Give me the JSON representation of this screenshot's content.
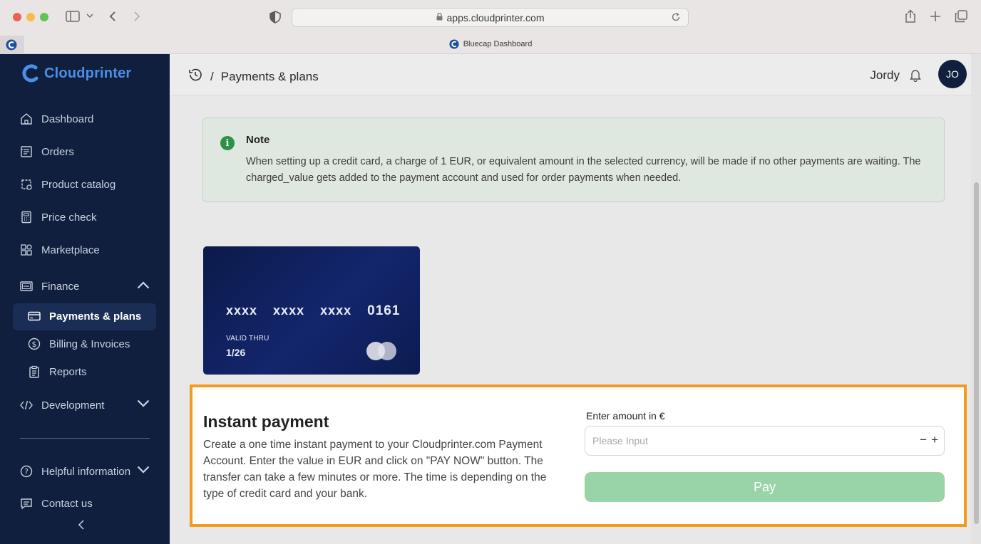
{
  "browser": {
    "url": "apps.cloudprinter.com",
    "tab_title": "Bluecap Dashboard"
  },
  "sidebar": {
    "logo_text": "Cloudprinter",
    "items": [
      {
        "label": "Dashboard",
        "icon": "home-icon"
      },
      {
        "label": "Orders",
        "icon": "orders-icon"
      },
      {
        "label": "Product catalog",
        "icon": "catalog-icon"
      },
      {
        "label": "Price check",
        "icon": "calculator-icon"
      },
      {
        "label": "Marketplace",
        "icon": "marketplace-icon"
      },
      {
        "label": "Finance",
        "icon": "finance-icon"
      },
      {
        "label": "Development",
        "icon": "code-icon"
      },
      {
        "label": "Helpful information",
        "icon": "help-icon"
      },
      {
        "label": "Contact us",
        "icon": "chat-icon"
      }
    ],
    "finance_sub": [
      {
        "label": "Payments & plans",
        "icon": "card-icon",
        "active": true
      },
      {
        "label": "Billing & Invoices",
        "icon": "dollar-icon"
      },
      {
        "label": "Reports",
        "icon": "clipboard-icon"
      }
    ]
  },
  "header": {
    "breadcrumb_separator": "/",
    "page_title": "Payments & plans",
    "user_name": "Jordy",
    "avatar_initials": "JO"
  },
  "note": {
    "title": "Note",
    "body": "When setting up a credit card, a charge of 1 EUR, or equivalent amount in the selected currency, will be made if no other payments are waiting. The charged_value gets added to the payment account and used for order payments when needed."
  },
  "card": {
    "groups": [
      "xxxx",
      "xxxx",
      "xxxx",
      "0161"
    ],
    "valid_label": "VALID THRU",
    "valid_thru": "1/26",
    "brand_icon": "mastercard-icon"
  },
  "instant_payment": {
    "title": "Instant payment",
    "description": "Create a one time instant payment to your Cloudprinter.com Payment Account. Enter the value in EUR and click on \"PAY NOW\" button. The transfer can take a few minutes or more. The time is depending on the type of credit card and your bank.",
    "amount_label": "Enter amount in €",
    "amount_placeholder": "Please Input",
    "amount_value": "",
    "minus": "−",
    "plus": "+",
    "pay_label": "Pay"
  },
  "colors": {
    "sidebar_bg": "#0f1f3d",
    "highlight_border": "#f39a1f",
    "pay_button": "#99d4a8",
    "note_bg": "#dfe8e0",
    "brand_blue": "#4a8fe8"
  }
}
